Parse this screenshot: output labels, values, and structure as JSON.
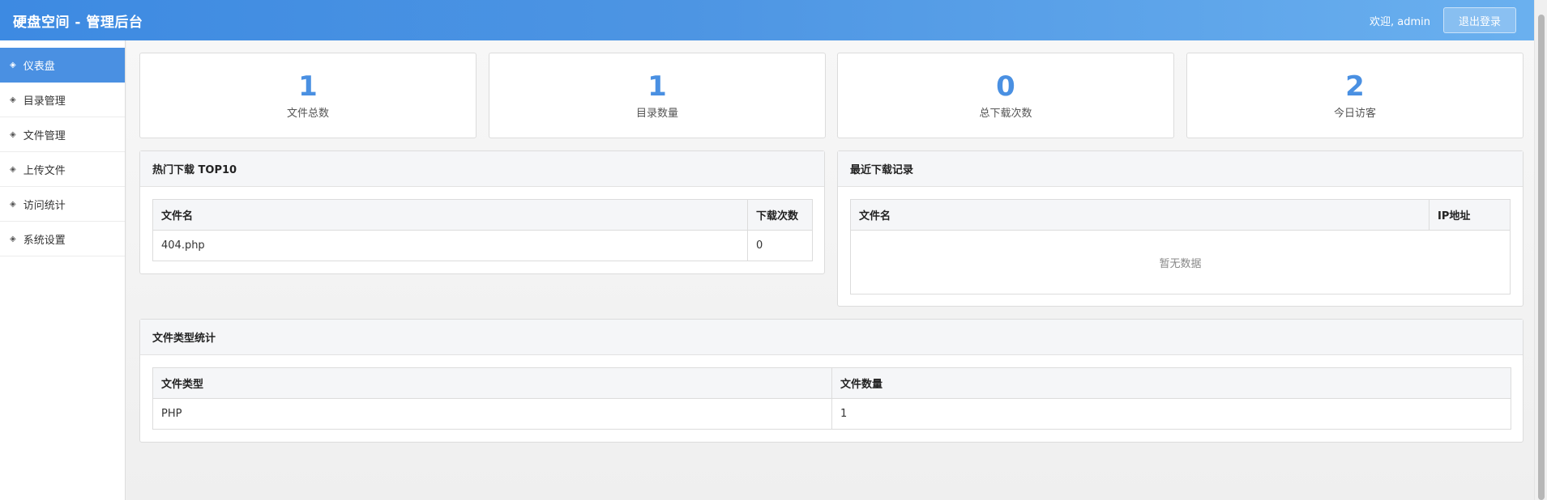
{
  "header": {
    "title": "硬盘空间 - 管理后台",
    "welcome": "欢迎, admin",
    "logout_label": "退出登录"
  },
  "sidebar": {
    "items": [
      {
        "label": "仪表盘",
        "active": true
      },
      {
        "label": "目录管理"
      },
      {
        "label": "文件管理"
      },
      {
        "label": "上传文件"
      },
      {
        "label": "访问统计"
      },
      {
        "label": "系统设置"
      }
    ],
    "bullet": "◈"
  },
  "stats": [
    {
      "value": "1",
      "label": "文件总数"
    },
    {
      "value": "1",
      "label": "目录数量"
    },
    {
      "value": "0",
      "label": "总下载次数"
    },
    {
      "value": "2",
      "label": "今日访客"
    }
  ],
  "hot_downloads": {
    "title": "热门下载 TOP10",
    "headers": [
      "文件名",
      "下载次数"
    ],
    "rows": [
      [
        "404.php",
        "0"
      ]
    ]
  },
  "recent_downloads": {
    "title": "最近下载记录",
    "headers": [
      "文件名",
      "IP地址"
    ],
    "empty_text": "暂无数据"
  },
  "file_types": {
    "title": "文件类型统计",
    "headers": [
      "文件类型",
      "文件数量"
    ],
    "rows": [
      [
        "PHP",
        "1"
      ]
    ]
  },
  "colors": {
    "accent": "#4a90e2",
    "header_start": "#3d8ae2",
    "header_end": "#6ab0ef"
  }
}
